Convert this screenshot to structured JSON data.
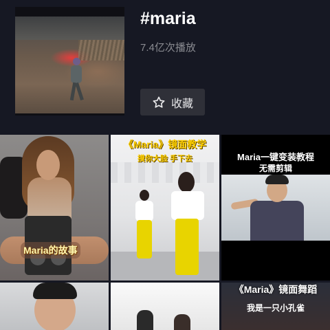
{
  "header": {
    "title": "#maria",
    "play_count": "7.4亿次播放",
    "favorite_label": "收藏"
  },
  "videos": [
    {
      "caption": "Maria的故事"
    },
    {
      "caption": "《Maria》镜面教学",
      "subcaption": "摸你大脸 手下去"
    },
    {
      "caption": "Maria一键变装教程",
      "subcaption": "无需剪辑"
    },
    {
      "caption": ""
    },
    {
      "caption": ""
    },
    {
      "caption": "《Maria》镜面舞蹈",
      "subcaption": "我是一只小孔雀"
    }
  ],
  "icons": {
    "favorite": "star-outline-icon"
  },
  "colors": {
    "background": "#161823",
    "button_bg": "#2f3038",
    "muted_text": "#8a8b91",
    "caption_yellow": "#ffd000"
  }
}
